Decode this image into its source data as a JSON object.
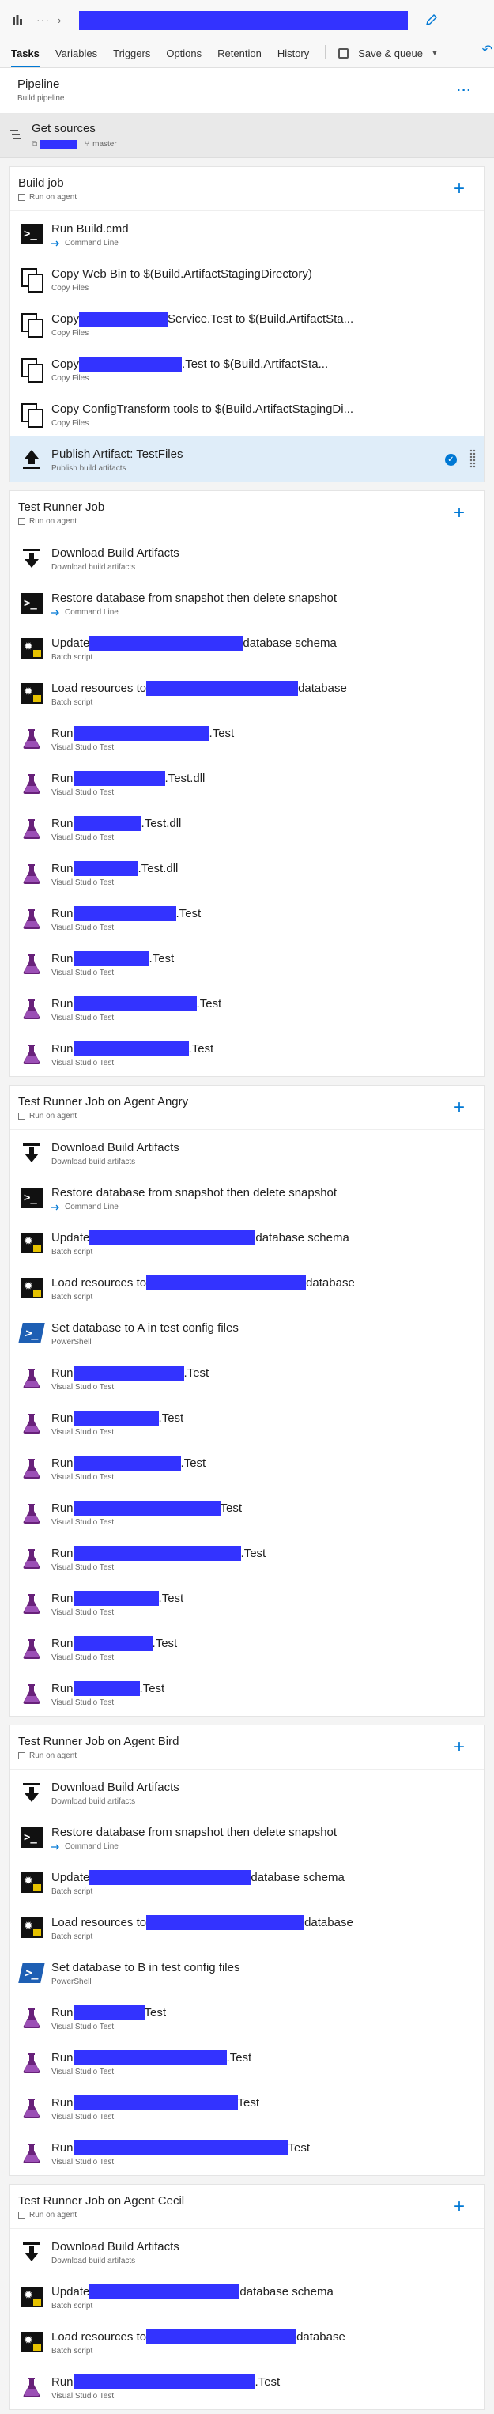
{
  "header": {
    "more": "···",
    "chevron": "›"
  },
  "tabs": [
    {
      "label": "Tasks",
      "active": true
    },
    {
      "label": "Variables"
    },
    {
      "label": "Triggers"
    },
    {
      "label": "Options"
    },
    {
      "label": "Retention"
    },
    {
      "label": "History"
    }
  ],
  "save_queue_label": "Save & queue",
  "pipeline": {
    "title": "Pipeline",
    "subtitle": "Build pipeline",
    "more": "···"
  },
  "get_sources": {
    "title": "Get sources",
    "branch": "master"
  },
  "phases": {
    "build": {
      "title": "Build job",
      "subtitle": "Run on agent",
      "tasks": [
        {
          "pre": "Run Build.cmd",
          "sub": "Command Line"
        },
        {
          "pre": "Copy Web Bin to $(Build.ArtifactStagingDirectory)",
          "sub": "Copy Files"
        },
        {
          "pre": "Copy ",
          "post": "Service.Test to $(Build.ArtifactSta...",
          "sub": "Copy Files"
        },
        {
          "pre": "Copy",
          "post": ".Test to $(Build.ArtifactSta...",
          "sub": "Copy Files"
        },
        {
          "pre": "Copy ConfigTransform tools to $(Build.ArtifactStagingDi...",
          "sub": "Copy Files"
        },
        {
          "pre": "Publish Artifact: TestFiles",
          "sub": "Publish build artifacts"
        }
      ]
    },
    "runner": {
      "title": "Test Runner Job",
      "subtitle": "Run on agent",
      "tasks": [
        {
          "pre": "Download Build Artifacts",
          "sub": "Download build artifacts"
        },
        {
          "pre": "Restore database from snapshot then delete snapshot",
          "sub": "Command Line"
        },
        {
          "pre": "Update ",
          "post": " database schema",
          "sub": "Batch script"
        },
        {
          "pre": "Load resources to ",
          "post": " database",
          "sub": "Batch script"
        },
        {
          "pre": "Run ",
          "post": ".Test",
          "sub": "Visual Studio Test"
        },
        {
          "pre": "Run ",
          "post": ".Test.dll",
          "sub": "Visual Studio Test"
        },
        {
          "pre": "Run ",
          "post": ".Test.dll",
          "sub": "Visual Studio Test"
        },
        {
          "pre": "Run ",
          "post": ".Test.dll",
          "sub": "Visual Studio Test"
        },
        {
          "pre": "Run ",
          "post": ".Test",
          "sub": "Visual Studio Test"
        },
        {
          "pre": "Run ",
          "post": ".Test",
          "sub": "Visual Studio Test"
        },
        {
          "pre": "Run",
          "post": ".Test",
          "sub": "Visual Studio Test"
        },
        {
          "pre": "Run ",
          "post": ".Test",
          "sub": "Visual Studio Test"
        }
      ]
    },
    "angry": {
      "title": "Test Runner Job on Agent Angry",
      "subtitle": "Run on agent",
      "tasks": [
        {
          "pre": "Download Build Artifacts",
          "sub": "Download build artifacts"
        },
        {
          "pre": "Restore database from snapshot then delete snapshot",
          "sub": "Command Line"
        },
        {
          "pre": "Update",
          "post": "database schema",
          "sub": "Batch script"
        },
        {
          "pre": "Load resources to ",
          "post": " database",
          "sub": "Batch script"
        },
        {
          "pre": "Set database to A in test config files",
          "sub": "PowerShell"
        },
        {
          "pre": "Run ",
          "post": ".Test",
          "sub": "Visual Studio Test"
        },
        {
          "pre": "Run ",
          "post": ".Test",
          "sub": "Visual Studio Test"
        },
        {
          "pre": "Run ",
          "post": ".Test",
          "sub": "Visual Studio Test"
        },
        {
          "pre": "Run ",
          "post": "Test",
          "sub": "Visual Studio Test"
        },
        {
          "pre": "Run ",
          "post": ".Test",
          "sub": "Visual Studio Test"
        },
        {
          "pre": "Run ",
          "post": ".Test",
          "sub": "Visual Studio Test"
        },
        {
          "pre": "Run ",
          "post": ".Test",
          "sub": "Visual Studio Test"
        },
        {
          "pre": "Run ",
          "post": ".Test",
          "sub": "Visual Studio Test"
        }
      ]
    },
    "bird": {
      "title": "Test Runner Job on Agent Bird",
      "subtitle": "Run on agent",
      "tasks": [
        {
          "pre": "Download Build Artifacts",
          "sub": "Download build artifacts"
        },
        {
          "pre": "Restore database from snapshot then delete snapshot",
          "sub": "Command Line"
        },
        {
          "pre": "Update ",
          "post": "database schema",
          "sub": "Batch script"
        },
        {
          "pre": "Load resources to ",
          "post": " database",
          "sub": "Batch script"
        },
        {
          "pre": "Set database to B in test config files",
          "sub": "PowerShell"
        },
        {
          "pre": "Run ",
          "post": "Test",
          "sub": "Visual Studio Test"
        },
        {
          "pre": "Run ",
          "post": ".Test",
          "sub": "Visual Studio Test"
        },
        {
          "pre": "Run ",
          "post": "Test",
          "sub": "Visual Studio Test"
        },
        {
          "pre": "Run ",
          "post": "Test",
          "sub": "Visual Studio Test"
        }
      ]
    },
    "cecil": {
      "title": "Test Runner Job on Agent Cecil",
      "subtitle": "Run on agent",
      "tasks": [
        {
          "pre": "Download Build Artifacts",
          "sub": "Download build artifacts"
        },
        {
          "pre": "Update ",
          "post": " database schema",
          "sub": "Batch script"
        },
        {
          "pre": "Load resources to ",
          "post": " database",
          "sub": "Batch script"
        },
        {
          "pre": "Run ",
          "post": ".Test",
          "sub": "Visual Studio Test"
        }
      ]
    }
  },
  "colors": {
    "accent": "#0078d4",
    "redaction": "#3333ff",
    "selected_row": "#dfedf9"
  }
}
